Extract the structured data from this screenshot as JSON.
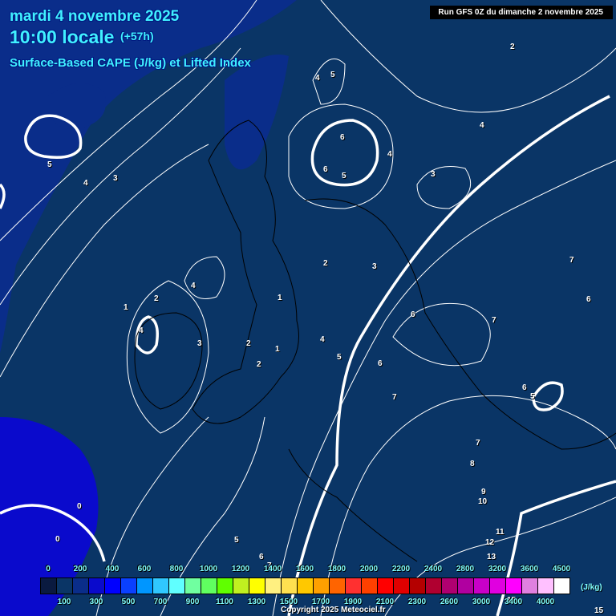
{
  "header": {
    "date": "mardi 4 novembre 2025",
    "time": "10:00 locale",
    "lead": "(+57h)",
    "product": "Surface-Based CAPE (J/kg) et Lifted Index",
    "run": "Run GFS 0Z du dimanche 2 novembre 2025"
  },
  "contour_labels": [
    "2",
    "4",
    "5",
    "6",
    "6",
    "5",
    "4",
    "4",
    "3",
    "5",
    "4",
    "3",
    "2",
    "3",
    "4",
    "1",
    "2",
    "4",
    "3",
    "2",
    "2",
    "1",
    "1",
    "4",
    "5",
    "6",
    "6",
    "7",
    "7",
    "6",
    "5",
    "7",
    "8",
    "9",
    "10",
    "11",
    "12",
    "13",
    "0",
    "0",
    "5",
    "6",
    "7",
    "15",
    "15"
  ],
  "legend": {
    "top_labels": [
      "0",
      "200",
      "400",
      "600",
      "800",
      "1000",
      "1200",
      "1400",
      "1600",
      "1800",
      "2000",
      "2200",
      "2400",
      "2800",
      "3200",
      "3600",
      "4500"
    ],
    "bottom_labels": [
      "100",
      "300",
      "500",
      "700",
      "900",
      "1100",
      "1300",
      "1500",
      "1700",
      "1900",
      "2100",
      "2300",
      "2600",
      "3000",
      "3400",
      "4000"
    ],
    "unit": "(J/kg)",
    "colors": [
      "#0a1a40",
      "#0a3566",
      "#0a2d8a",
      "#0a0acc",
      "#0000ff",
      "#0a40ff",
      "#0096ff",
      "#30c8ff",
      "#60ffff",
      "#70ffa0",
      "#60ff60",
      "#60ff00",
      "#c0f020",
      "#ffff00",
      "#fff080",
      "#ffe050",
      "#ffc800",
      "#ffa000",
      "#ff6400",
      "#ff3030",
      "#ff4000",
      "#ff0000",
      "#e00000",
      "#b40000",
      "#b00030",
      "#b00070",
      "#b000a0",
      "#c800c8",
      "#e000e0",
      "#ff00ff",
      "#e080e0",
      "#ffc0ff",
      "#ffffff"
    ]
  },
  "copyright": "Copyright 2025 Meteociel.fr"
}
